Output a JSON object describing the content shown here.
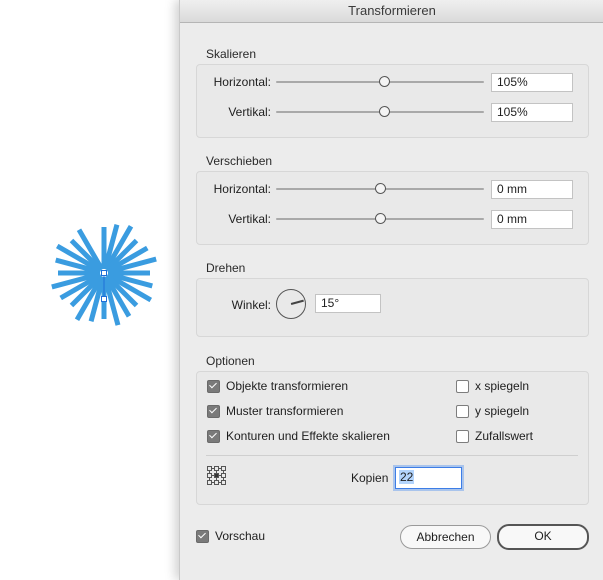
{
  "dialog": {
    "title": "Transformieren"
  },
  "scale": {
    "title": "Skalieren",
    "horizontal": {
      "label": "Horizontal:",
      "value": "105%",
      "slider_fraction": 0.52
    },
    "vertical": {
      "label": "Vertikal:",
      "value": "105%",
      "slider_fraction": 0.52
    }
  },
  "move": {
    "title": "Verschieben",
    "horizontal": {
      "label": "Horizontal:",
      "value": "0 mm",
      "slider_fraction": 0.5
    },
    "vertical": {
      "label": "Vertikal:",
      "value": "0 mm",
      "slider_fraction": 0.5
    }
  },
  "rotate": {
    "title": "Drehen",
    "angle_label": "Winkel:",
    "angle_value": "15°"
  },
  "options": {
    "title": "Optionen",
    "transform_objects": {
      "label": "Objekte transformieren",
      "checked": true
    },
    "transform_patterns": {
      "label": "Muster transformieren",
      "checked": true
    },
    "scale_strokes": {
      "label": "Konturen und Effekte skalieren",
      "checked": true
    },
    "reflect_x": {
      "label": "x spiegeln",
      "checked": false
    },
    "reflect_y": {
      "label": "y spiegeln",
      "checked": false
    },
    "random": {
      "label": "Zufallswert",
      "checked": false
    },
    "copies_label": "Kopien",
    "copies_value": "22",
    "reference_point_icon": "reference-point-grid-icon"
  },
  "preview": {
    "label": "Vorschau",
    "checked": true
  },
  "buttons": {
    "cancel": "Abbrechen",
    "ok": "OK"
  },
  "colors": {
    "artwork": "#3a9ce0",
    "selection": "#1e6fd9"
  }
}
